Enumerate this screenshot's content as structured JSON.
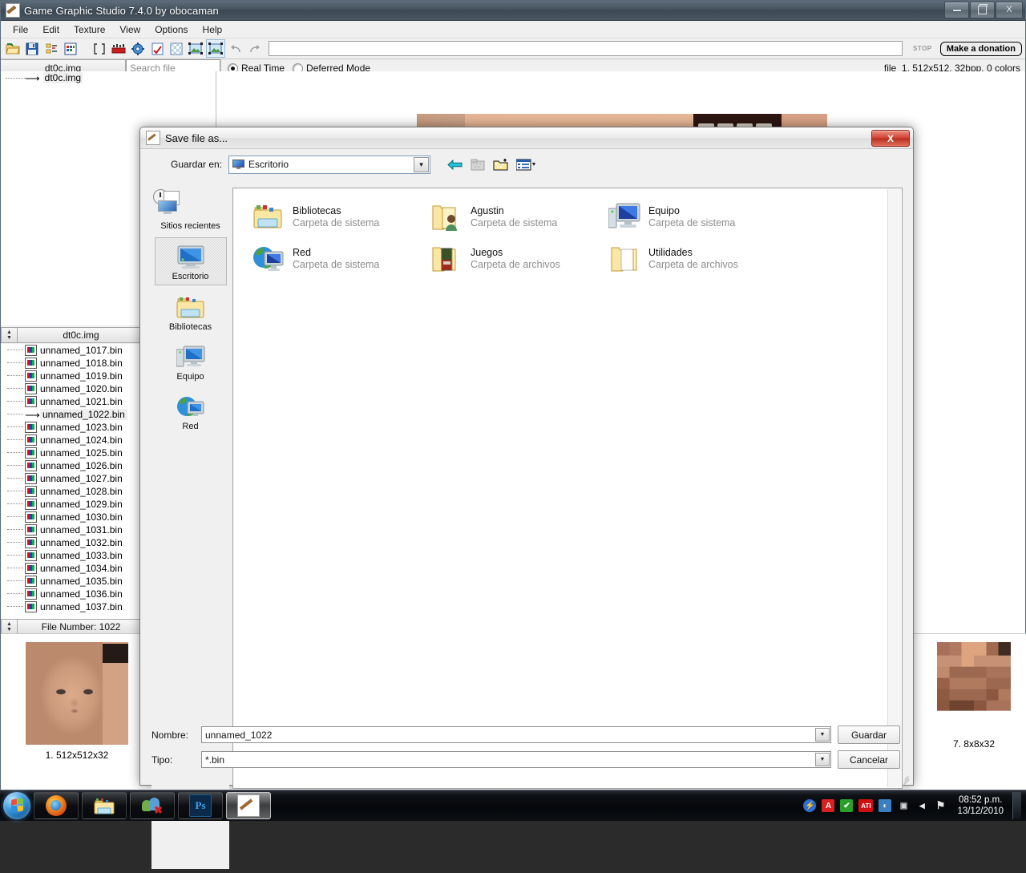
{
  "app": {
    "title": "Game Graphic Studio 7.4.0 by obocaman",
    "title_icon": "pencil-ruler-icon",
    "window_buttons": {
      "minimize": "minimize-icon",
      "maximize": "maximize-icon",
      "close": "X"
    },
    "menu": [
      "File",
      "Edit",
      "Texture",
      "View",
      "Options",
      "Help"
    ],
    "toolbar": {
      "icons": [
        "open-folder-icon",
        "save-disk-icon",
        "sort-list-icon",
        "palette-grid-icon",
        "brackets-icon",
        "film-strip-icon",
        "gear-icon",
        "checked-document-icon",
        "checker-transparency-icon",
        "image-export-icon",
        "image-selected-icon",
        "undo-icon",
        "redo-icon"
      ],
      "path_value": "",
      "stop_label": "STOP",
      "donation_label": "Make a donation"
    },
    "tree_header": "dt0c.img",
    "search_placeholder": "Search file",
    "mode": {
      "realtime_label": "Real Time",
      "deferred_label": "Deferred Mode",
      "selected": "Real Time"
    },
    "status": "file_1, 512x512, 32bpp, 0 colors",
    "tree_root": "dt0c.img",
    "filelist": {
      "header": "dt0c.img",
      "footer": "File Number: 1022",
      "selected": "unnamed_1022.bin",
      "items": [
        "unnamed_1017.bin",
        "unnamed_1018.bin",
        "unnamed_1019.bin",
        "unnamed_1020.bin",
        "unnamed_1021.bin",
        "unnamed_1022.bin",
        "unnamed_1023.bin",
        "unnamed_1024.bin",
        "unnamed_1025.bin",
        "unnamed_1026.bin",
        "unnamed_1027.bin",
        "unnamed_1028.bin",
        "unnamed_1029.bin",
        "unnamed_1030.bin",
        "unnamed_1031.bin",
        "unnamed_1032.bin",
        "unnamed_1033.bin",
        "unnamed_1034.bin",
        "unnamed_1035.bin",
        "unnamed_1036.bin",
        "unnamed_1037.bin"
      ]
    },
    "thumbnails": [
      {
        "caption": "1. 512x512x32",
        "name": "face-texture-thumbnail"
      },
      {
        "caption": "7. 8x8x32",
        "name": "pixel-texture-thumbnail"
      }
    ]
  },
  "dialog": {
    "title": "Save file as...",
    "title_icon": "pencil-ruler-icon",
    "close_label": "X",
    "lookin_label": "Guardar en:",
    "lookin_value": "Escritorio",
    "nav_icons": [
      "back-arrow-icon",
      "up-folder-icon",
      "new-folder-icon",
      "view-mode-icon"
    ],
    "places": [
      {
        "label": "Sitios recientes",
        "icon": "recent-places-icon",
        "selected": false
      },
      {
        "label": "Escritorio",
        "icon": "desktop-monitor-icon",
        "selected": true
      },
      {
        "label": "Bibliotecas",
        "icon": "libraries-folder-icon",
        "selected": false
      },
      {
        "label": "Equipo",
        "icon": "computer-icon",
        "selected": false
      },
      {
        "label": "Red",
        "icon": "network-globe-icon",
        "selected": false
      }
    ],
    "files": [
      {
        "name": "Bibliotecas",
        "type": "Carpeta de sistema",
        "icon": "libraries-folder-icon"
      },
      {
        "name": "Agustin",
        "type": "Carpeta de sistema",
        "icon": "user-folder-icon"
      },
      {
        "name": "Equipo",
        "type": "Carpeta de sistema",
        "icon": "computer-icon"
      },
      {
        "name": "Red",
        "type": "Carpeta de sistema",
        "icon": "network-globe-icon"
      },
      {
        "name": "Juegos",
        "type": "Carpeta de archivos",
        "icon": "games-folder-icon"
      },
      {
        "name": "Utilidades",
        "type": "Carpeta de archivos",
        "icon": "open-folder-icon"
      }
    ],
    "name_label": "Nombre:",
    "name_value": "unnamed_1022",
    "type_label": "Tipo:",
    "type_value": "*.bin",
    "save_button": "Guardar",
    "cancel_button": "Cancelar"
  },
  "taskbar": {
    "start_icon": "windows-orb-icon",
    "items": [
      {
        "name": "firefox-taskbar-button",
        "icon": "firefox-icon"
      },
      {
        "name": "explorer-taskbar-button",
        "icon": "folder-icon"
      },
      {
        "name": "messenger-taskbar-button",
        "icon": "msn-messenger-icon"
      },
      {
        "name": "photoshop-taskbar-button",
        "icon": "photoshop-icon",
        "label": "Ps"
      },
      {
        "name": "ggs-taskbar-button",
        "icon": "pencil-ruler-icon",
        "active": true
      }
    ],
    "tray": [
      {
        "name": "tray-flash-icon",
        "glyph": "⚡",
        "color": "#2f6fd0"
      },
      {
        "name": "tray-avira-icon",
        "glyph": "A",
        "color": "#d92020"
      },
      {
        "name": "tray-check-icon",
        "glyph": "✔",
        "color": "#2aa02a"
      },
      {
        "name": "tray-ati-icon",
        "glyph": "ATI",
        "color": "#d01010"
      },
      {
        "name": "tray-palette-icon",
        "glyph": "◐",
        "color": "#3a7fc1"
      },
      {
        "name": "tray-network-icon",
        "glyph": "▣",
        "color": "#c9c9c9"
      },
      {
        "name": "tray-volume-icon",
        "glyph": "◂",
        "color": "#e0e0e0"
      },
      {
        "name": "tray-flag-icon",
        "glyph": "⚑",
        "color": "#e0e0e0"
      }
    ],
    "time": "08:52 p.m.",
    "date": "13/12/2010"
  }
}
